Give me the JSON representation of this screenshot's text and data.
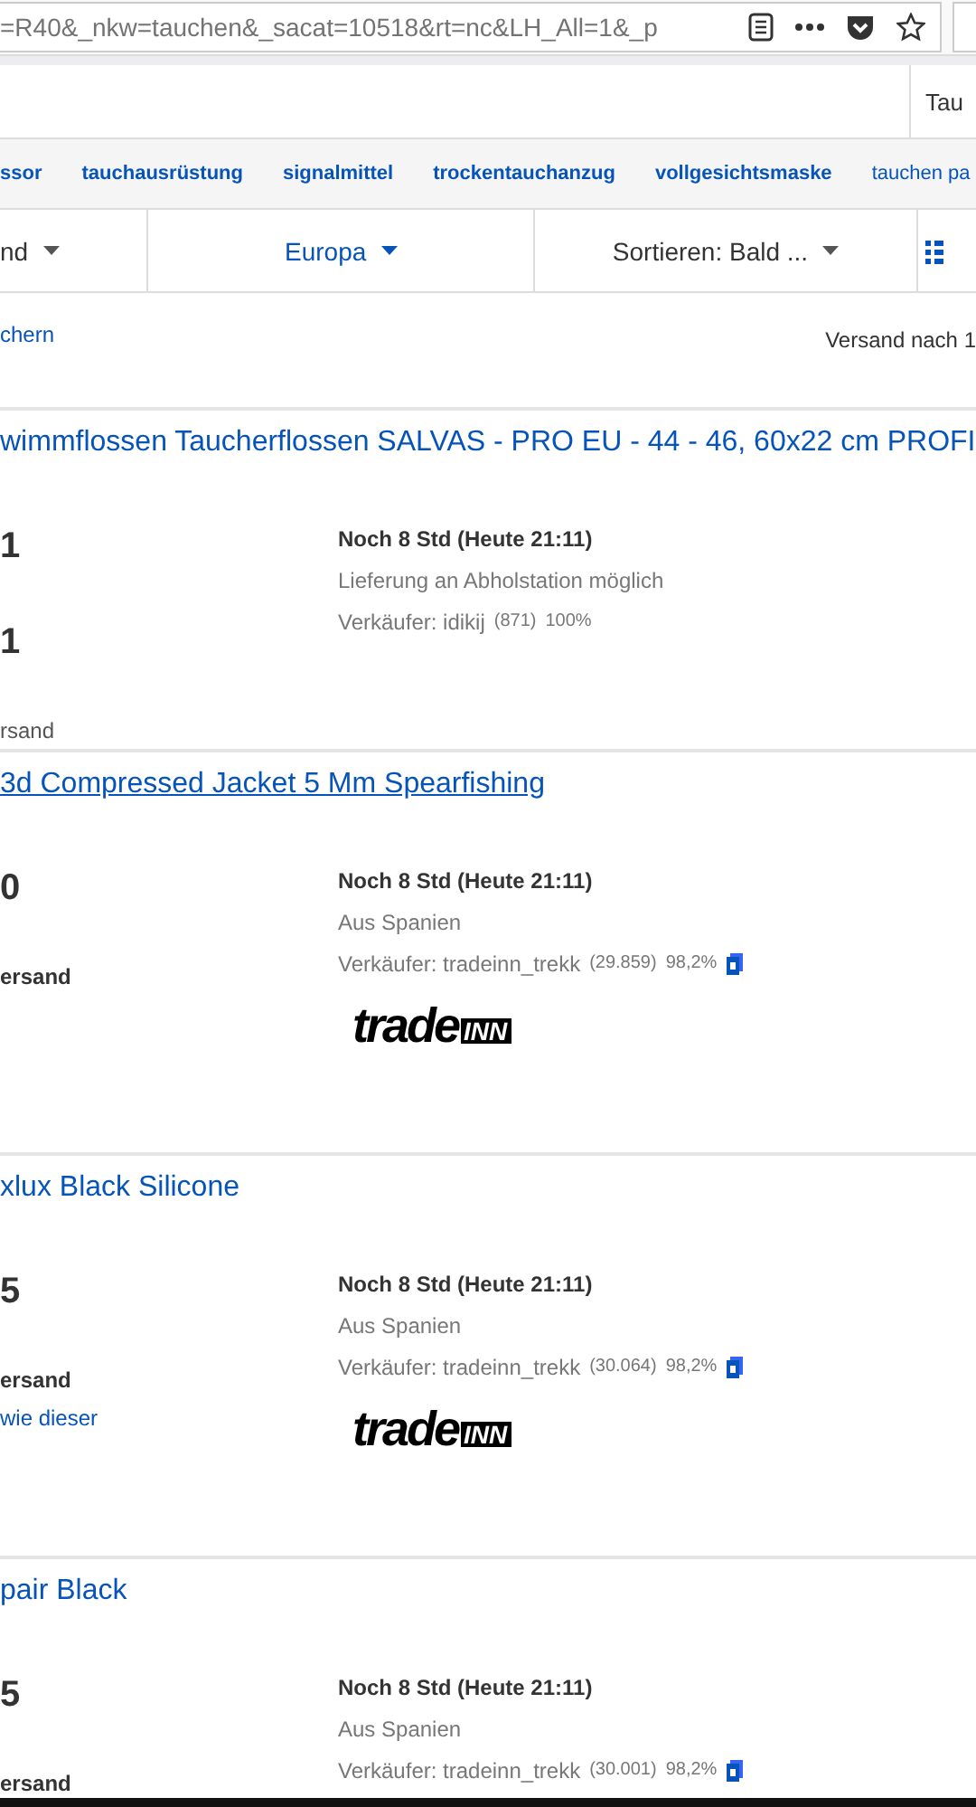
{
  "address_bar": {
    "url": "=R40&_nkw=tauchen&_sacat=10518&rt=nc&LH_All=1&_p"
  },
  "search_tab": {
    "label": "Tau"
  },
  "related_searches": [
    "ssor",
    "tauchausrüstung",
    "signalmittel",
    "trockentauchanzug",
    "vollgesichtsmaske",
    "tauchen pa"
  ],
  "filters": [
    {
      "label": "nd",
      "selected": false
    },
    {
      "label": "Europa",
      "selected": true
    },
    {
      "label": "Sortieren: Bald ...",
      "selected": false
    }
  ],
  "save_search": "chern",
  "ship_to": "Versand nach 1",
  "listings": [
    {
      "title": "wimmflossen Taucherflossen SALVAS - PRO EU - 44 - 46, 60x22 cm PROFI",
      "hovered": false,
      "left": [
        {
          "kind": "price",
          "text": "1"
        },
        {
          "kind": "price",
          "text": "1"
        },
        {
          "kind": "shipping",
          "text": "rsand"
        }
      ],
      "time": "Noch 8 Std (Heute 21:11)",
      "location": "Lieferung an Abholstation möglich",
      "seller": "Verkäufer: idikij",
      "feedback": "(871)",
      "percent": "100%",
      "top_rated": false
    },
    {
      "title": "3d Compressed Jacket 5 Mm Spearfishing",
      "hovered": true,
      "left": [
        {
          "kind": "price",
          "text": "0"
        },
        {
          "kind": "shipping_bold",
          "text": "ersand"
        }
      ],
      "time": "Noch 8 Std (Heute 21:11)",
      "location": "Aus Spanien",
      "seller": "Verkäufer: tradeinn_trekk",
      "feedback": "(29.859)",
      "percent": "98,2%",
      "top_rated": true,
      "logo": {
        "word": "trade",
        "badge": "INN"
      }
    },
    {
      "title": "xlux Black Silicone",
      "hovered": false,
      "left": [
        {
          "kind": "price",
          "text": "5"
        },
        {
          "kind": "shipping_bold",
          "text": "ersand"
        },
        {
          "kind": "link",
          "text": "wie dieser"
        }
      ],
      "time": "Noch 8 Std (Heute 21:11)",
      "location": "Aus Spanien",
      "seller": "Verkäufer: tradeinn_trekk",
      "feedback": "(30.064)",
      "percent": "98,2%",
      "top_rated": true,
      "logo": {
        "word": "trade",
        "badge": "INN"
      }
    },
    {
      "title": "pair Black",
      "hovered": false,
      "left": [
        {
          "kind": "price",
          "text": "5"
        },
        {
          "kind": "shipping_bold",
          "text": "ersand"
        }
      ],
      "time": "Noch 8 Std (Heute 21:11)",
      "location": "Aus Spanien",
      "seller": "Verkäufer: tradeinn_trekk",
      "feedback": "(30.001)",
      "percent": "98,2%",
      "top_rated": true
    }
  ]
}
